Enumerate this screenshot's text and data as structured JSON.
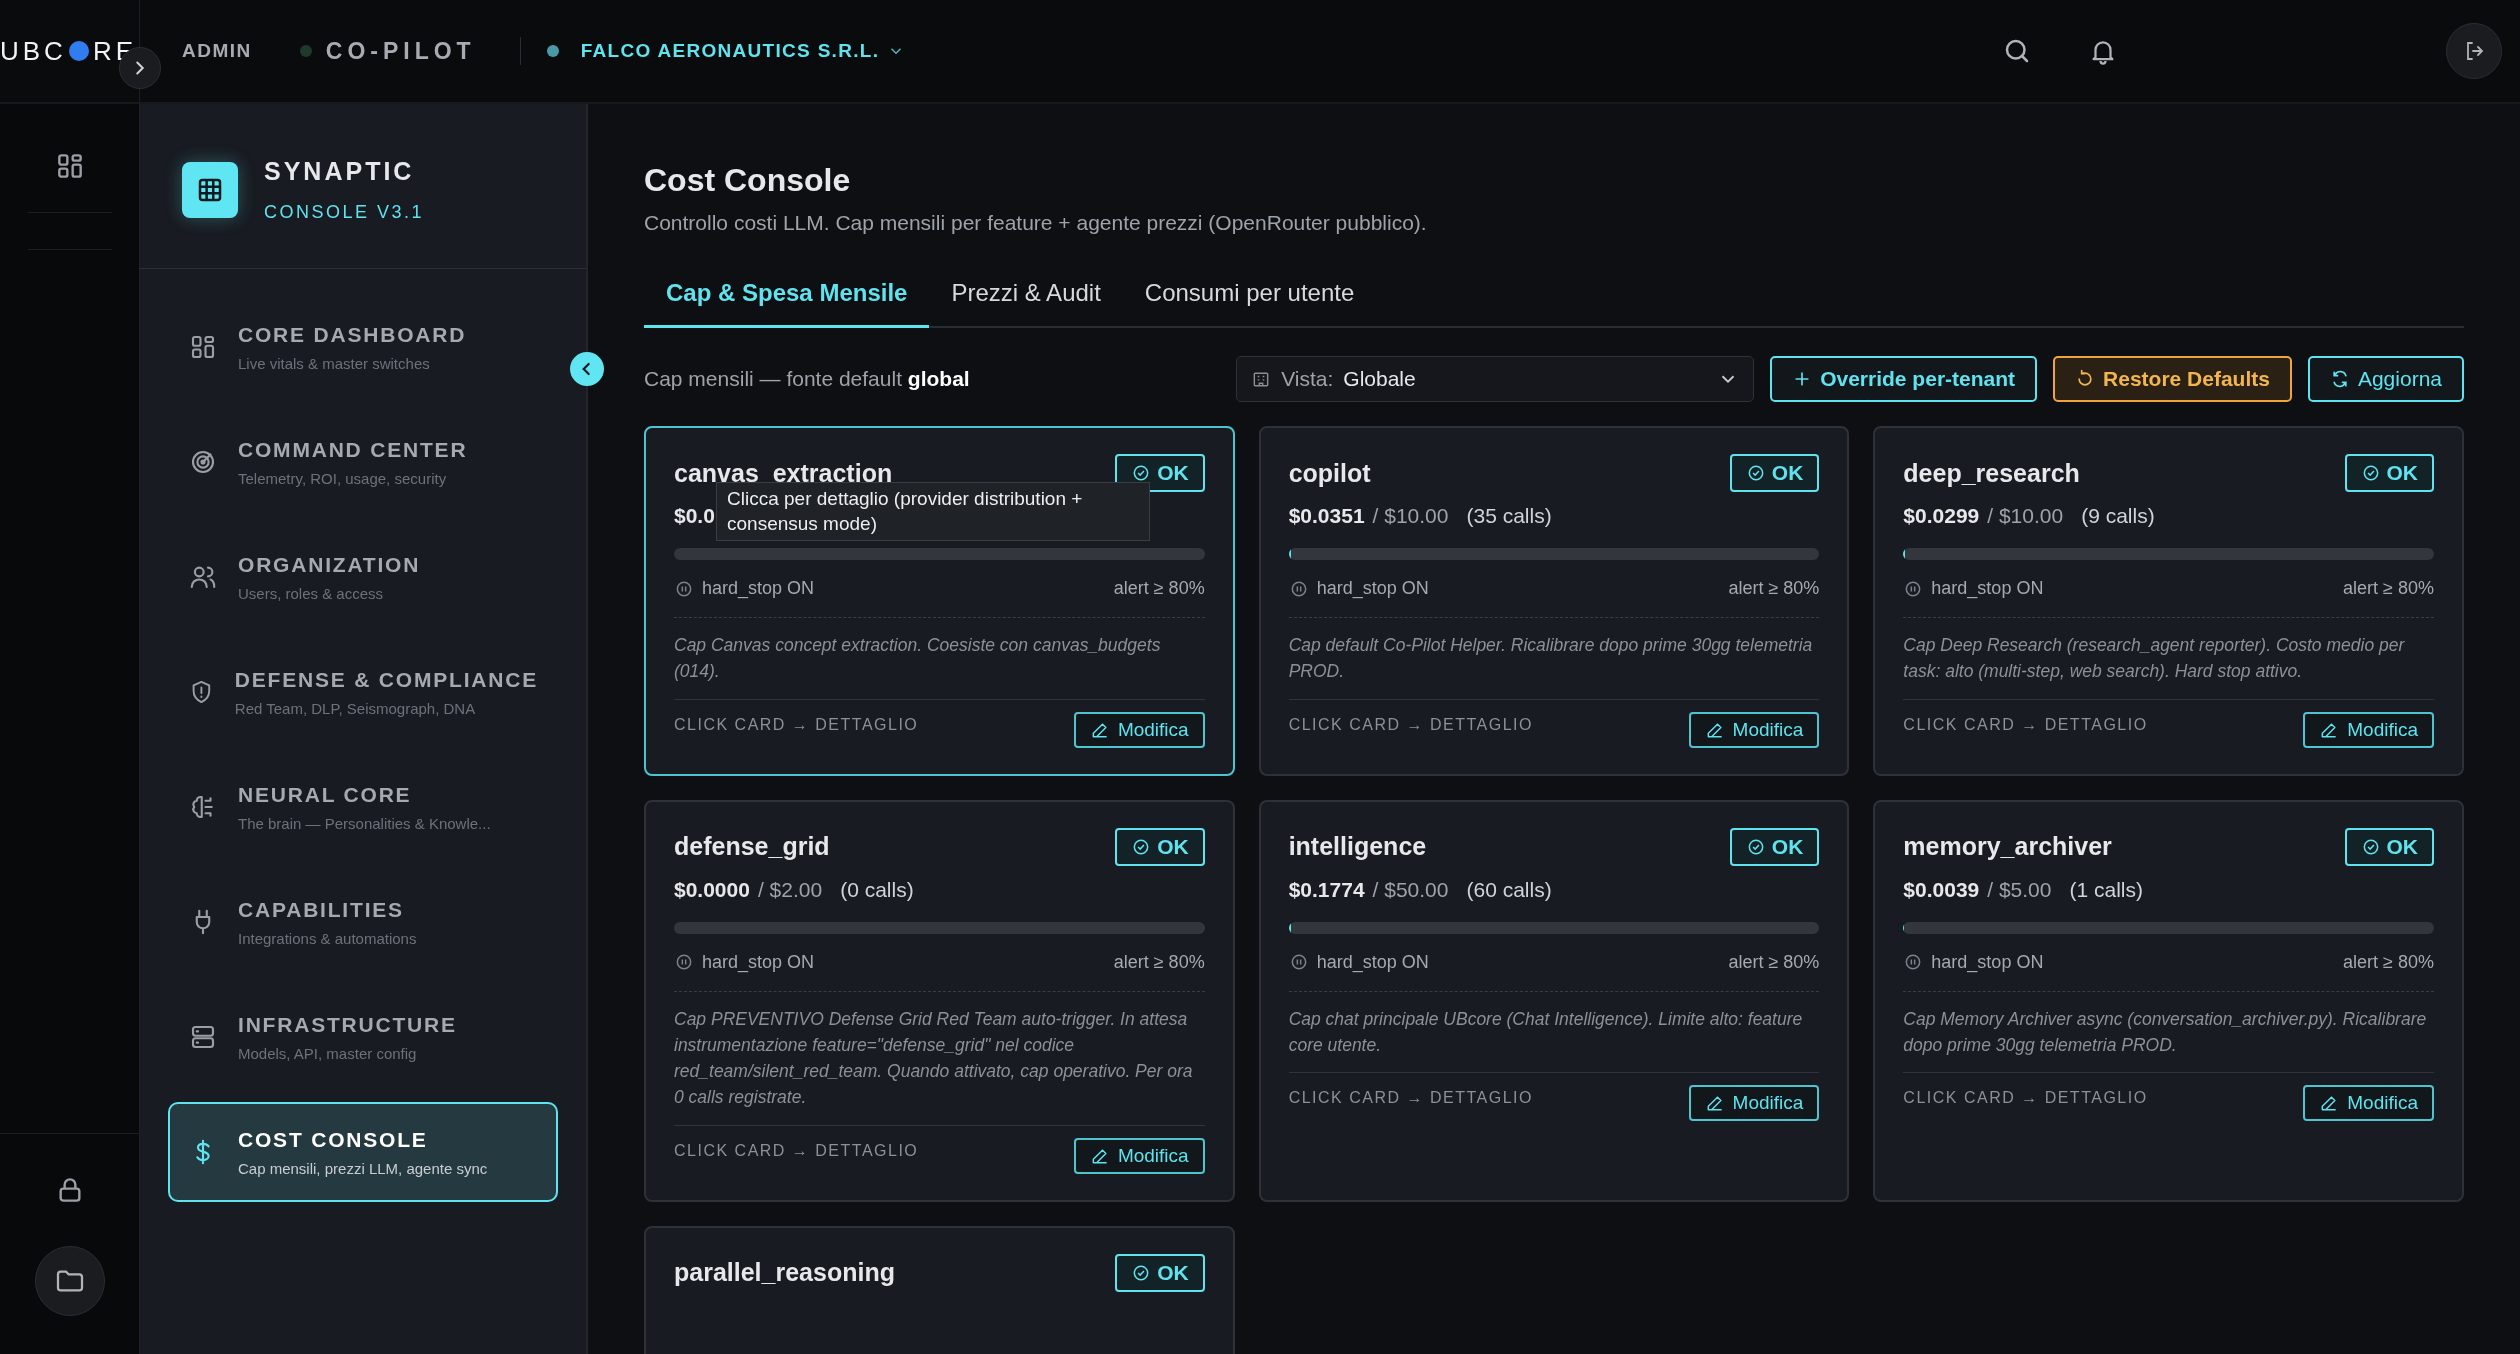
{
  "topbar": {
    "logo_left": "UBC",
    "logo_right": "RE",
    "role": "ADMIN",
    "product": "CO-PILOT",
    "tenant": "FALCO AERONAUTICS S.R.L."
  },
  "brand": {
    "title": "SYNAPTIC",
    "subtitle": "CONSOLE V3.1"
  },
  "nav": [
    {
      "title": "CORE DASHBOARD",
      "subtitle": "Live vitals & master switches",
      "selected": false
    },
    {
      "title": "COMMAND CENTER",
      "subtitle": "Telemetry, ROI, usage, security",
      "selected": false
    },
    {
      "title": "ORGANIZATION",
      "subtitle": "Users, roles & access",
      "selected": false
    },
    {
      "title": "DEFENSE & COMPLIANCE",
      "subtitle": "Red Team, DLP, Seismograph, DNA",
      "selected": false
    },
    {
      "title": "NEURAL CORE",
      "subtitle": "The brain — Personalities & Knowle...",
      "selected": false
    },
    {
      "title": "CAPABILITIES",
      "subtitle": "Integrations & automations",
      "selected": false
    },
    {
      "title": "INFRASTRUCTURE",
      "subtitle": "Models, API, master config",
      "selected": false
    },
    {
      "title": "COST CONSOLE",
      "subtitle": "Cap mensili, prezzi LLM, agente sync",
      "selected": true
    }
  ],
  "page": {
    "title": "Cost Console",
    "subtitle": "Controllo costi LLM. Cap mensili per feature + agente prezzi (OpenRouter pubblico)."
  },
  "tabs": [
    {
      "label": "Cap & Spesa Mensile",
      "selected": true
    },
    {
      "label": "Prezzi & Audit",
      "selected": false
    },
    {
      "label": "Consumi per utente",
      "selected": false
    }
  ],
  "toolbar": {
    "caption": "Cap mensili — fonte default **global**",
    "view_label": "Vista:",
    "view_value": "Globale",
    "buttons": [
      {
        "label": "Override per-tenant",
        "kind": "add"
      },
      {
        "label": "Restore Defaults",
        "kind": "restore"
      },
      {
        "label": "Aggiorna",
        "kind": "refresh"
      }
    ]
  },
  "cards": [
    {
      "name": "canvas_extraction",
      "status": "OK",
      "selected": true,
      "spent": "$0.0",
      "hard_stop": "hard_stop ON",
      "alert": "alert ≥ 80%",
      "note": "Cap Canvas concept extraction. Coesiste con canvas_budgets (014).",
      "footer": "CLICK CARD → DETTAGLIO",
      "action": "Modifica",
      "tooltip": "Clicca per dettaglio (provider distribution + consensus mode)"
    },
    {
      "name": "copilot",
      "status": "OK",
      "selected": false,
      "spent": "$0.0351",
      "limit": "/ $10.00",
      "calls": "(35 calls)",
      "level": 0.004,
      "hard_stop": "hard_stop ON",
      "alert": "alert ≥ 80%",
      "note": "Cap default Co-Pilot Helper. Ricalibrare dopo prime 30gg telemetria PROD.",
      "footer": "CLICK CARD → DETTAGLIO",
      "action": "Modifica"
    },
    {
      "name": "deep_research",
      "status": "OK",
      "selected": false,
      "spent": "$0.0299",
      "limit": "/ $10.00",
      "calls": "(9 calls)",
      "level": 0.003,
      "hard_stop": "hard_stop ON",
      "alert": "alert ≥ 80%",
      "note": "Cap Deep Research (research_agent reporter). Costo medio per task: alto (multi-step, web search). Hard stop attivo.",
      "footer": "CLICK CARD → DETTAGLIO",
      "action": "Modifica"
    },
    {
      "name": "defense_grid",
      "status": "OK",
      "selected": false,
      "spent": "$0.0000",
      "limit": "/ $2.00",
      "calls": "(0 calls)",
      "hard_stop": "hard_stop ON",
      "alert": "alert ≥ 80%",
      "note": "Cap PREVENTIVO Defense Grid Red Team auto-trigger. In attesa instrumentazione feature=\"defense_grid\" nel codice red_team/silent_red_team. Quando attivato, cap operativo. Per ora 0 calls registrate.",
      "footer": "CLICK CARD → DETTAGLIO",
      "action": "Modifica"
    },
    {
      "name": "intelligence",
      "status": "OK",
      "selected": false,
      "spent": "$0.1774",
      "limit": "/ $50.00",
      "calls": "(60 calls)",
      "level": 0.0035,
      "hard_stop": "hard_stop ON",
      "alert": "alert ≥ 80%",
      "note": "Cap chat principale UBcore (Chat Intelligence). Limite alto: feature core utente.",
      "footer": "CLICK CARD → DETTAGLIO",
      "action": "Modifica"
    },
    {
      "name": "memory_archiver",
      "status": "OK",
      "selected": false,
      "spent": "$0.0039",
      "limit": "/ $5.00",
      "calls": "(1 calls)",
      "level": 0.001,
      "hard_stop": "hard_stop ON",
      "alert": "alert ≥ 80%",
      "note": "Cap Memory Archiver async (conversation_archiver.py). Ricalibrare dopo prime 30gg telemetria PROD.",
      "footer": "CLICK CARD → DETTAGLIO",
      "action": "Modifica"
    },
    {
      "name": "parallel_reasoning",
      "status": "OK",
      "selected": false
    }
  ]
}
